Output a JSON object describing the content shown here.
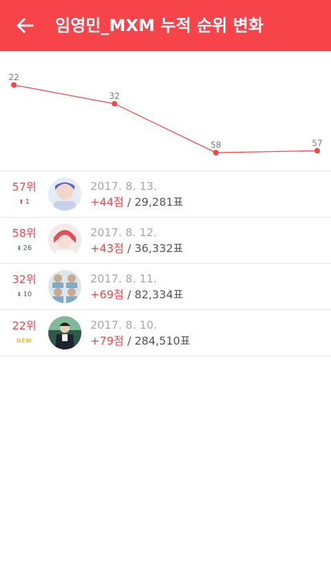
{
  "header": {
    "title": "임영민_MXM 누적 순위 변화",
    "back_icon": "arrow-left-icon"
  },
  "colors": {
    "accent": "#f7434a",
    "down": "#3b86e0",
    "new_badge": "#f5b946",
    "muted": "#a8a8a8"
  },
  "chart_data": {
    "type": "line",
    "x": [
      "2017. 8. 10.",
      "2017. 8. 11.",
      "2017. 8. 12.",
      "2017. 8. 13."
    ],
    "values": [
      22,
      32,
      58,
      57
    ],
    "data_labels": [
      "22",
      "32",
      "58",
      "57"
    ],
    "y_inverted": true,
    "ylim": [
      22,
      58
    ],
    "grid": false,
    "title": "",
    "xlabel": "",
    "ylabel": ""
  },
  "entries": [
    {
      "rank": "57위",
      "change_dir": "up",
      "change_icon": "arrow-up-icon",
      "change_arrow": "⬆",
      "change": "1",
      "date": "2017. 8. 13.",
      "points": "+44점",
      "votes_sep": " / ",
      "votes": "29,281표"
    },
    {
      "rank": "58위",
      "change_dir": "down",
      "change_icon": "arrow-down-icon",
      "change_arrow": "⬇",
      "change": "26",
      "date": "2017. 8. 12.",
      "points": "+43점",
      "votes_sep": " / ",
      "votes": "36,332표"
    },
    {
      "rank": "32위",
      "change_dir": "down",
      "change_icon": "arrow-down-icon",
      "change_arrow": "⬇",
      "change": "10",
      "date": "2017. 8. 11.",
      "points": "+69점",
      "votes_sep": " / ",
      "votes": "82,334표"
    },
    {
      "rank": "22위",
      "change_dir": "new",
      "change_icon": "",
      "change_arrow": "",
      "change": "NEW",
      "date": "2017. 8. 10.",
      "points": "+79점",
      "votes_sep": " / ",
      "votes": "284,510표"
    }
  ]
}
